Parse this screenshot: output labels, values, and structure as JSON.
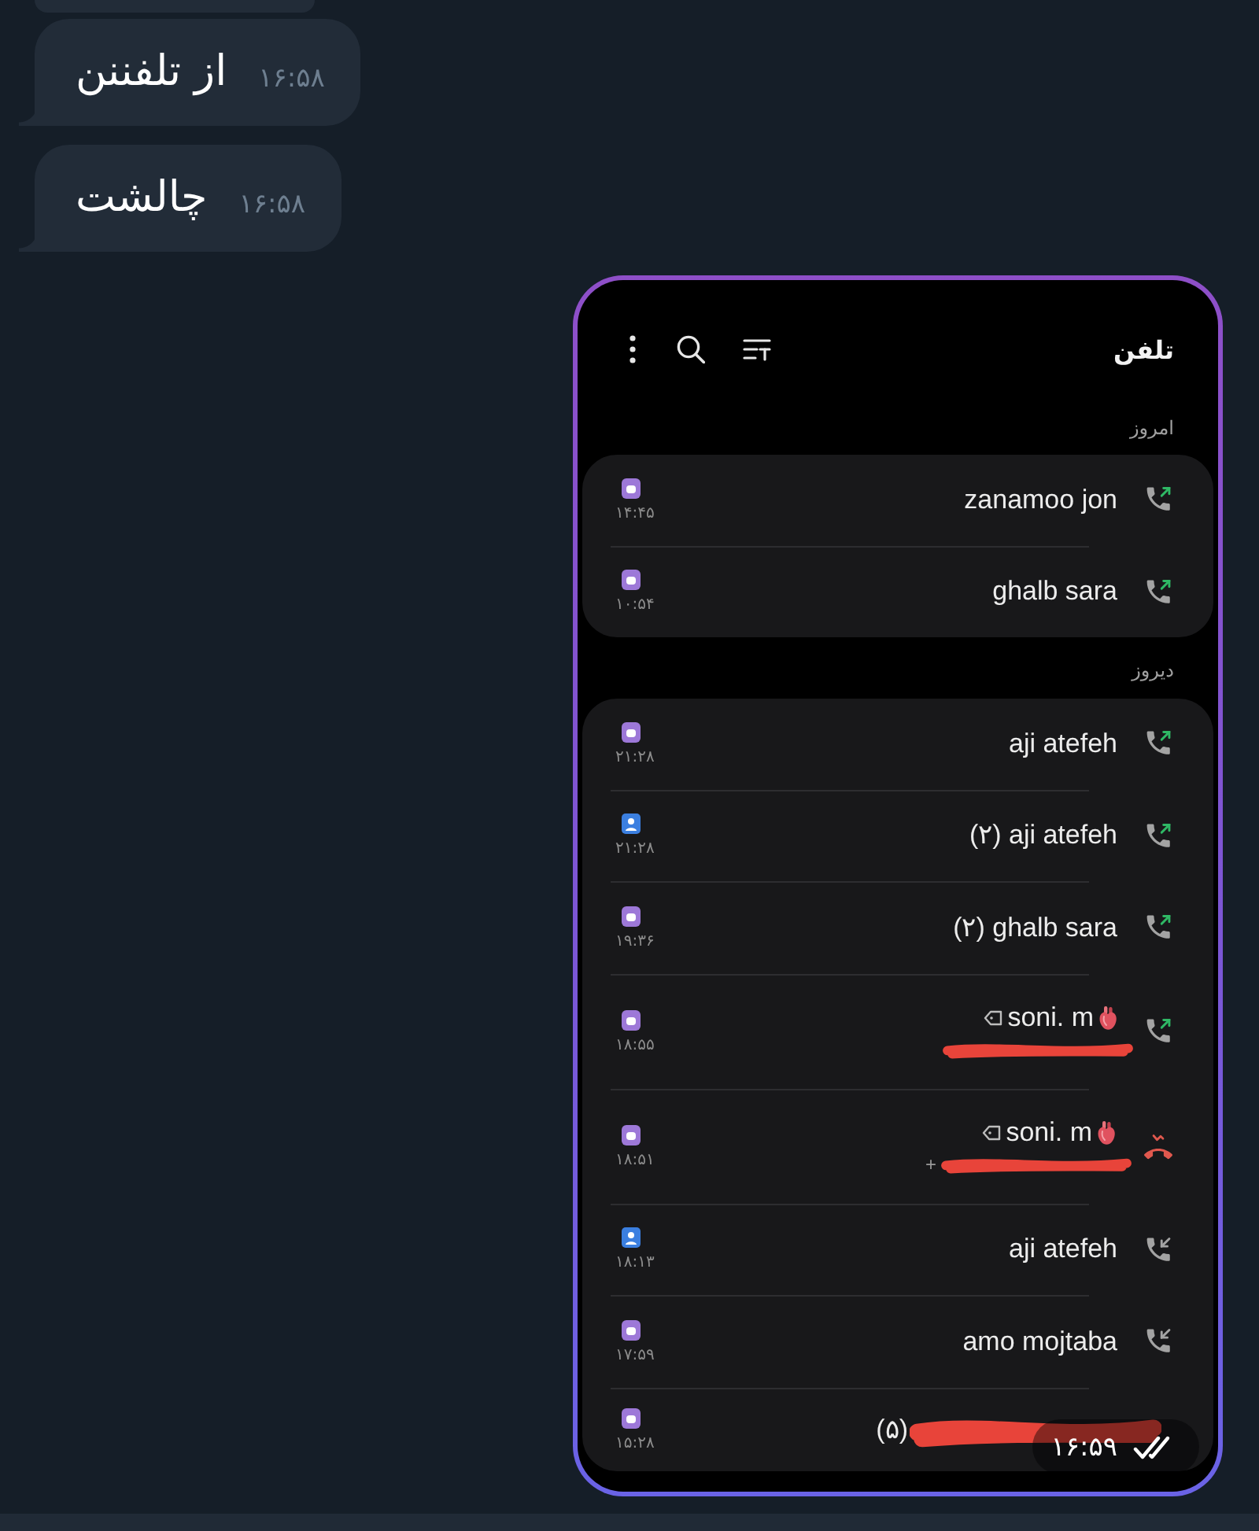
{
  "chat": {
    "messages": [
      {
        "kind": "clipped"
      },
      {
        "kind": "text",
        "text": "از تلفننن",
        "time": "۱۶:۵۸"
      },
      {
        "kind": "text",
        "text": "چالشت",
        "time": "۱۶:۵۸"
      }
    ]
  },
  "photo_message": {
    "time": "۱۶:۵۹",
    "read": true,
    "screenshot": {
      "title": "تلفن",
      "sections": [
        {
          "label": "امروز",
          "calls": [
            {
              "name": "zanamoo jon",
              "time": "۱۴:۴۵",
              "badge": {
                "kind": "sim"
              },
              "call_icon": {
                "kind": "outgoing"
              }
            },
            {
              "name": "ghalb sara",
              "time": "۱۰:۵۴",
              "badge": {
                "kind": "sim"
              },
              "call_icon": {
                "kind": "outgoing"
              }
            }
          ]
        },
        {
          "label": "دیروز",
          "calls": [
            {
              "name": "aji atefeh",
              "time": "۲۱:۲۸",
              "badge": {
                "kind": "sim"
              },
              "call_icon": {
                "kind": "outgoing"
              }
            },
            {
              "name": "(۲) aji atefeh",
              "time": "۲۱:۲۸",
              "badge": {
                "kind": "contact"
              },
              "call_icon": {
                "kind": "outgoing"
              }
            },
            {
              "name": "(۲) ghalb sara",
              "time": "۱۹:۳۶",
              "badge": {
                "kind": "sim"
              },
              "call_icon": {
                "kind": "outgoing"
              }
            },
            {
              "name": "soni. m",
              "tag": true,
              "heart": true,
              "redaction": {
                "kind": "below"
              },
              "time": "۱۸:۵۵",
              "badge": {
                "kind": "sim"
              },
              "call_icon": {
                "kind": "outgoing"
              }
            },
            {
              "name": "soni. m",
              "tag": true,
              "heart": true,
              "number": "+",
              "redaction": {
                "kind": "below"
              },
              "time": "۱۸:۵۱",
              "badge": {
                "kind": "sim"
              },
              "call_icon": {
                "kind": "missed"
              }
            },
            {
              "name": "aji atefeh",
              "time": "۱۸:۱۳",
              "badge": {
                "kind": "contact"
              },
              "call_icon": {
                "kind": "incoming"
              }
            },
            {
              "name": "amo mojtaba",
              "time": "۱۷:۵۹",
              "badge": {
                "kind": "sim"
              },
              "call_icon": {
                "kind": "incoming"
              }
            },
            {
              "name": "(۵)",
              "redaction": {
                "kind": "inline"
              },
              "time": "۱۵:۲۸",
              "badge": {
                "kind": "sim"
              }
            }
          ]
        }
      ]
    }
  }
}
